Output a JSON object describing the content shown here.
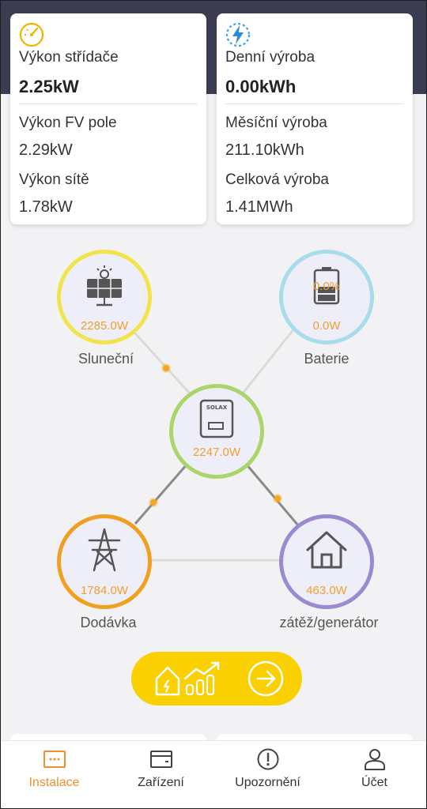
{
  "stats": {
    "inverter": {
      "title": "Výkon střídače",
      "value": "2.25kW",
      "pv_label": "Výkon FV pole",
      "pv_value": "2.29kW",
      "grid_label": "Výkon sítě",
      "grid_value": "1.78kW"
    },
    "yield": {
      "title": "Denní výroba",
      "value": "0.00kWh",
      "month_label": "Měsíční výroba",
      "month_value": "211.10kWh",
      "total_label": "Celková výroba",
      "total_value": "1.41MWh"
    }
  },
  "flow": {
    "solar": {
      "label": "Sluneční",
      "power": "2285.0W",
      "ring_color": "#f2e34a"
    },
    "battery": {
      "label": "Baterie",
      "soc": "0.0%",
      "power": "0.0W",
      "ring_color": "#a9dcea"
    },
    "inverter": {
      "power": "2247.0W",
      "ring_color": "#a9d56a",
      "brand": "SOLAX"
    },
    "grid": {
      "label": "Dodávka",
      "power": "1784.0W",
      "ring_color": "#f0a020"
    },
    "load": {
      "label": "zátěž/generátor",
      "power": "463.0W",
      "ring_color": "#9c8ad0"
    }
  },
  "nav": {
    "items": [
      {
        "label": "Instalace",
        "icon": "installation-icon",
        "active": true
      },
      {
        "label": "Zařízení",
        "icon": "device-icon",
        "active": false
      },
      {
        "label": "Upozornění",
        "icon": "alert-icon",
        "active": false
      },
      {
        "label": "Účet",
        "icon": "account-icon",
        "active": false
      }
    ]
  },
  "colors": {
    "accent": "#f0902a",
    "header": "#3b3d52",
    "action_button": "#fbd000",
    "flow_dot": "#f5a623"
  }
}
